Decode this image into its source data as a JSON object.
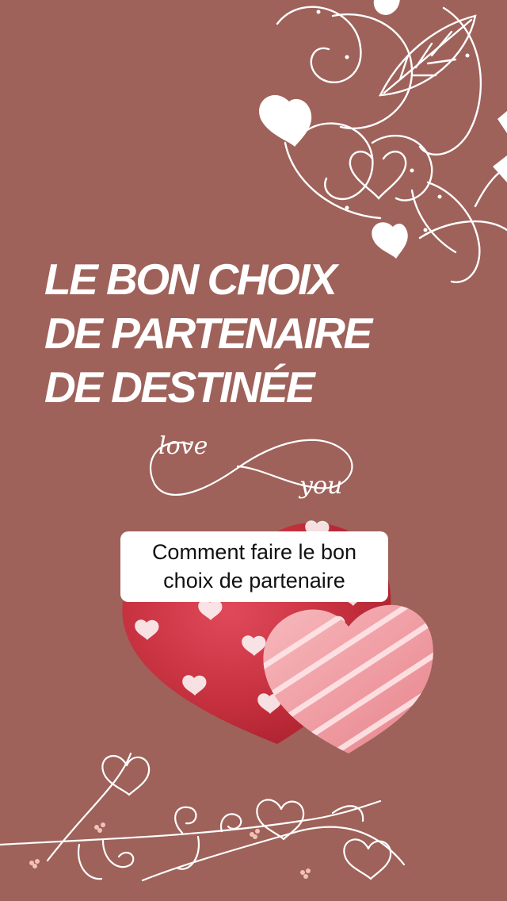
{
  "headline": {
    "line1": "LE BON CHOIX",
    "line2": "DE PARTENAIRE",
    "line3": "DE DESTINÉE"
  },
  "script_art": {
    "word1": "love",
    "word2": "you"
  },
  "caption": {
    "text": "Comment faire le bon choix de partenaire"
  },
  "colors": {
    "background": "#9e625a",
    "text": "#ffffff",
    "caption_bg": "#ffffff",
    "caption_text": "#111111",
    "heart_red": "#c4323f",
    "heart_pink": "#f0a0a6"
  }
}
